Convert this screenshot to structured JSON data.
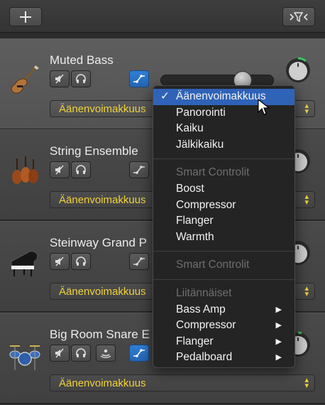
{
  "toolbar": {
    "add_icon": "plus-icon",
    "filter_icon": "automation-filter-icon"
  },
  "tracks": [
    {
      "name": "Muted Bass",
      "icon": "bass-guitar-icon",
      "automation": "Äänenvoimakkuus",
      "has_slider": true
    },
    {
      "name": "String Ensemble",
      "icon": "violin-icon",
      "automation": "Äänenvoimakkuus"
    },
    {
      "name": "Steinway Grand P",
      "icon": "grand-piano-icon",
      "automation": "Äänenvoimakkuus"
    },
    {
      "name": "Big Room Snare E",
      "icon": "drum-kit-icon",
      "automation": "Äänenvoimakkuus"
    }
  ],
  "menu": {
    "items": [
      {
        "label": "Äänenvoimakkuus",
        "checked": true,
        "selected": true
      },
      {
        "label": "Panorointi"
      },
      {
        "label": "Kaiku"
      },
      {
        "label": "Jälkikaiku"
      },
      {
        "separator": true
      },
      {
        "label": "Smart Controlit",
        "disabled": true
      },
      {
        "label": "Boost"
      },
      {
        "label": "Compressor"
      },
      {
        "label": "Flanger"
      },
      {
        "label": "Warmth"
      },
      {
        "separator": true
      },
      {
        "label": "Smart Controlit",
        "disabled": true
      },
      {
        "separator": true
      },
      {
        "label": "Liitännäiset",
        "disabled": true
      },
      {
        "label": "Bass Amp",
        "submenu": true
      },
      {
        "label": "Compressor",
        "submenu": true
      },
      {
        "label": "Flanger",
        "submenu": true
      },
      {
        "label": "Pedalboard",
        "submenu": true
      }
    ]
  },
  "colors": {
    "accent_blue": "#2f63b8",
    "automation_yellow": "#f0d23c",
    "knob_green": "#3cc35a"
  }
}
